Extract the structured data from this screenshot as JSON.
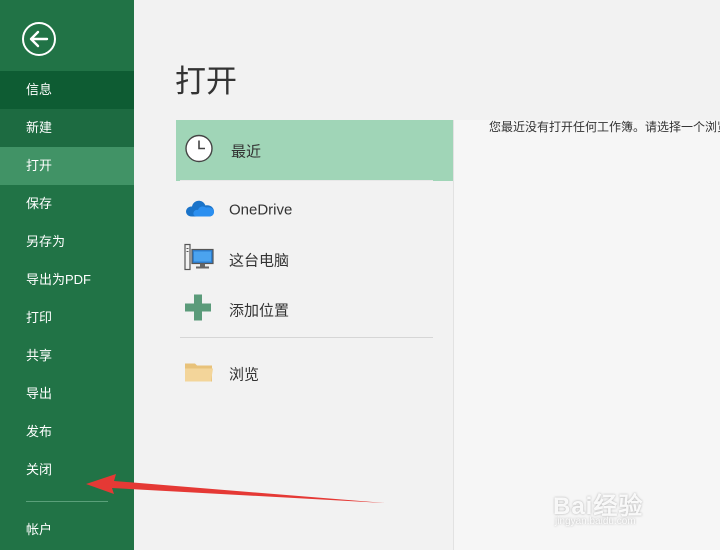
{
  "sidebar": {
    "items": [
      {
        "label": "信息"
      },
      {
        "label": "新建"
      },
      {
        "label": "打开"
      },
      {
        "label": "保存"
      },
      {
        "label": "另存为"
      },
      {
        "label": "导出为PDF"
      },
      {
        "label": "打印"
      },
      {
        "label": "共享"
      },
      {
        "label": "导出"
      },
      {
        "label": "发布"
      },
      {
        "label": "关闭"
      }
    ],
    "account": "帐户"
  },
  "main": {
    "title": "打开",
    "locations": {
      "recent": "最近",
      "onedrive": "OneDrive",
      "this_pc": "这台电脑",
      "add_place": "添加位置",
      "browse": "浏览"
    },
    "message": "您最近没有打开任何工作簿。请选择一个浏览位置"
  },
  "watermark": {
    "brand": "Bai经验",
    "url": "jingyan.baidu.com"
  },
  "colors": {
    "sidebar": "#217346",
    "active": "#419366",
    "recent_highlight": "#a0d5b7",
    "arrow": "#e53935"
  }
}
